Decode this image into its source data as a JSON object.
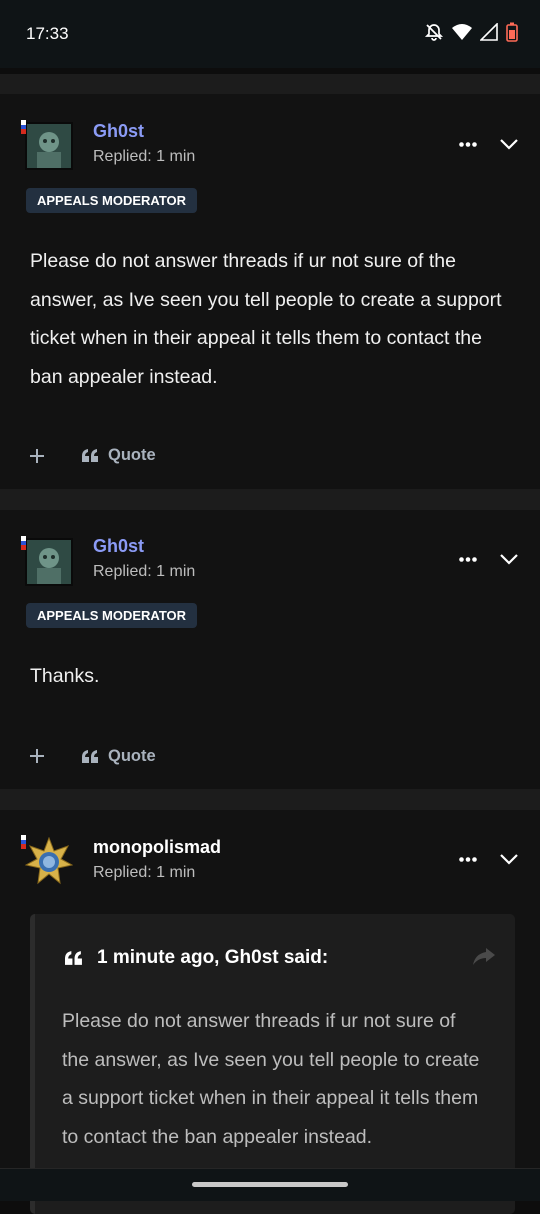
{
  "status_bar": {
    "time": "17:33",
    "icons": [
      "bell-off-icon",
      "wifi-icon",
      "signal-icon",
      "battery-low-icon"
    ]
  },
  "colors": {
    "background": "#0d0d0d",
    "card": "#121212",
    "accent_username": "#8b9bf5",
    "badge_bg": "#233040",
    "quote_bg": "#1d1d1d"
  },
  "posts": [
    {
      "username": "Gh0st",
      "replied": "Replied: 1 min",
      "badge": "APPEALS MODERATOR",
      "content": "Please do not answer threads if ur not sure of the answer, as Ive seen you tell people to create a support ticket when in their appeal it tells them to contact the ban appealer instead.",
      "plus_label": "+",
      "quote_label": "Quote"
    },
    {
      "username": "Gh0st",
      "replied": "Replied: 1 min",
      "badge": "APPEALS MODERATOR",
      "content": "Thanks.",
      "plus_label": "+",
      "quote_label": "Quote"
    },
    {
      "username": "monopolismad",
      "replied": "Replied: 1 min",
      "quote": {
        "header": "1 minute ago, Gh0st said:",
        "text": "Please do not answer threads if ur not sure of the answer, as Ive seen you tell people to create a support ticket when in their appeal it tells them to contact the ban appealer instead."
      }
    }
  ]
}
